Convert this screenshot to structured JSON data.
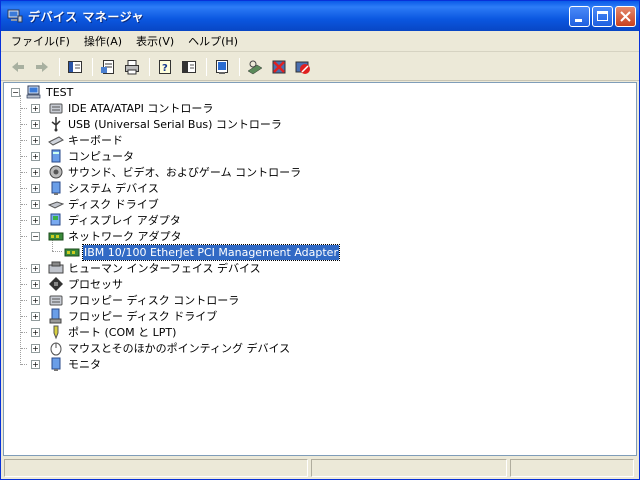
{
  "window": {
    "title": "デバイス マネージャ"
  },
  "menu": [
    {
      "label": "ファイル(F)"
    },
    {
      "label": "操作(A)"
    },
    {
      "label": "表示(V)"
    },
    {
      "label": "ヘルプ(H)"
    }
  ],
  "toolbar": {
    "icons": [
      "back-icon",
      "forward-icon",
      "show-hide-icon",
      "properties-icon",
      "print-icon",
      "help-icon",
      "view-icon",
      "refresh-icon",
      "scan-hardware-icon",
      "uninstall-icon",
      "disable-icon"
    ]
  },
  "tree": {
    "root": "TEST",
    "items": [
      {
        "label": "IDE ATA/ATAPI コントローラ",
        "icon": "ide-controller-icon",
        "expanded": false
      },
      {
        "label": "USB (Universal Serial Bus) コントローラ",
        "icon": "usb-icon",
        "expanded": false
      },
      {
        "label": "キーボード",
        "icon": "keyboard-icon",
        "expanded": false
      },
      {
        "label": "コンピュータ",
        "icon": "computer-icon",
        "expanded": false
      },
      {
        "label": "サウンド、ビデオ、およびゲーム コントローラ",
        "icon": "sound-icon",
        "expanded": false
      },
      {
        "label": "システム デバイス",
        "icon": "system-device-icon",
        "expanded": false
      },
      {
        "label": "ディスク ドライブ",
        "icon": "disk-drive-icon",
        "expanded": false
      },
      {
        "label": "ディスプレイ アダプタ",
        "icon": "display-adapter-icon",
        "expanded": false
      },
      {
        "label": "ネットワーク アダプタ",
        "icon": "network-adapter-icon",
        "expanded": true,
        "children": [
          {
            "label": "IBM 10/100 EtherJet PCI Management Adapter",
            "icon": "network-card-icon",
            "selected": true
          }
        ]
      },
      {
        "label": "ヒューマン インターフェイス デバイス",
        "icon": "hid-icon",
        "expanded": false
      },
      {
        "label": "プロセッサ",
        "icon": "processor-icon",
        "expanded": false
      },
      {
        "label": "フロッピー ディスク コントローラ",
        "icon": "floppy-controller-icon",
        "expanded": false
      },
      {
        "label": "フロッピー ディスク ドライブ",
        "icon": "floppy-drive-icon",
        "expanded": false
      },
      {
        "label": "ポート (COM と LPT)",
        "icon": "port-icon",
        "expanded": false
      },
      {
        "label": "マウスとそのほかのポインティング デバイス",
        "icon": "mouse-icon",
        "expanded": false
      },
      {
        "label": "モニタ",
        "icon": "monitor-icon",
        "expanded": false
      }
    ]
  },
  "colors": {
    "titlebar": "#0a5ae8",
    "selection": "#316ac5",
    "window_bg": "#ece9d8"
  }
}
